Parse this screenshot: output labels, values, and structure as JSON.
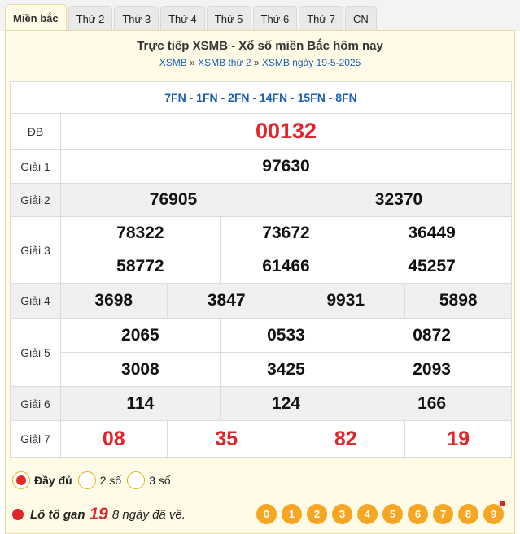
{
  "tabs": [
    "Miền bắc",
    "Thứ 2",
    "Thứ 3",
    "Thứ 4",
    "Thứ 5",
    "Thứ 6",
    "Thứ 7",
    "CN"
  ],
  "header": {
    "title": "Trực tiếp XSMB - Xổ số miền Bắc hôm nay",
    "crumb1": "XSMB",
    "sep": "»",
    "crumb2": "XSMB thứ 2",
    "crumb3": "XSMB ngày 19-5-2025"
  },
  "codes": "7FN - 1FN - 2FN - 14FN - 15FN - 8FN",
  "prizes": {
    "db": {
      "label": "ĐB",
      "values": [
        "00132"
      ]
    },
    "g1": {
      "label": "Giải 1",
      "values": [
        "97630"
      ]
    },
    "g2": {
      "label": "Giải 2",
      "values": [
        "76905",
        "32370"
      ]
    },
    "g3": {
      "label": "Giải 3",
      "values": [
        "78322",
        "73672",
        "36449",
        "58772",
        "61466",
        "45257"
      ]
    },
    "g4": {
      "label": "Giải 4",
      "values": [
        "3698",
        "3847",
        "9931",
        "5898"
      ]
    },
    "g5": {
      "label": "Giải 5",
      "values": [
        "2065",
        "0533",
        "0872",
        "3008",
        "3425",
        "2093"
      ]
    },
    "g6": {
      "label": "Giải 6",
      "values": [
        "114",
        "124",
        "166"
      ]
    },
    "g7": {
      "label": "Giải 7",
      "values": [
        "08",
        "35",
        "82",
        "19"
      ]
    }
  },
  "options": {
    "full": "Đầy đủ",
    "two": "2 số",
    "three": "3 số",
    "selected": "full"
  },
  "loto_gan": {
    "label": "Lô tô gan",
    "number": "19",
    "note": "8 ngày đã về.",
    "balls": [
      "0",
      "1",
      "2",
      "3",
      "4",
      "5",
      "6",
      "7",
      "8",
      "9"
    ]
  },
  "colors": {
    "accent": "#e0252b",
    "link": "#1a5fb4",
    "ball": "#f5a623",
    "panel": "#fffbe6"
  }
}
